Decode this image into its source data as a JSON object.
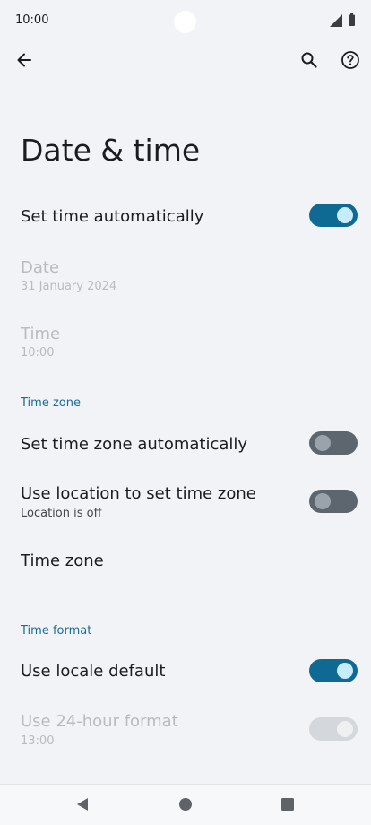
{
  "status_bar": {
    "time": "10:00"
  },
  "page": {
    "title": "Date & time"
  },
  "settings": {
    "set_time_auto": {
      "label": "Set time automatically",
      "enabled": true
    },
    "date": {
      "label": "Date",
      "value": "31 January 2024"
    },
    "time": {
      "label": "Time",
      "value": "10:00"
    },
    "time_zone_section": "Time zone",
    "set_tz_auto": {
      "label": "Set time zone automatically",
      "enabled": false
    },
    "use_location": {
      "label": "Use location to set time zone",
      "summary": "Location is off",
      "enabled": false
    },
    "time_zone": {
      "label": "Time zone"
    },
    "time_format_section": "Time format",
    "locale_default": {
      "label": "Use locale default",
      "enabled": true
    },
    "use_24h": {
      "label": "Use 24-hour format",
      "summary": "13:00",
      "enabled": true
    }
  },
  "colors": {
    "background": "#f1f3f6",
    "accent": "#1a6d97",
    "switch_on": "#0f6a93",
    "switch_off": "#5d656e",
    "disabled_text": "#b9bbbf"
  },
  "icons": {
    "back": "arrow-left",
    "search": "magnifier",
    "help": "question-circle",
    "nav_back": "triangle-left",
    "nav_home": "circle",
    "nav_recents": "square"
  }
}
